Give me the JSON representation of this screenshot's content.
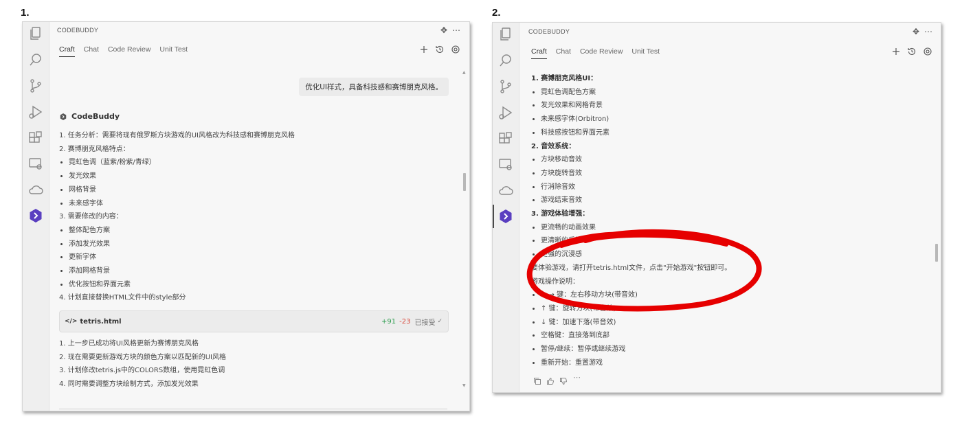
{
  "labels": {
    "left": "1.",
    "right": "2."
  },
  "colors": {
    "accent_dark": "#333333",
    "added": "#2e9c4e",
    "removed": "#d9483b",
    "annotation": "#e60000",
    "logo": "#5a3fc0"
  },
  "panel1": {
    "app_title": "CODEBUDDY",
    "tabs": [
      "Craft",
      "Chat",
      "Code Review",
      "Unit Test"
    ],
    "user_message": "优化UI样式，具备科技感和赛博朋克风格。",
    "bot_name": "CodeBuddy",
    "lines": [
      {
        "text": "1. 任务分析：需要将现有俄罗斯方块游戏的UI风格改为科技感和赛博朋克风格",
        "bullet": false
      },
      {
        "text": "2. 赛博朋克风格特点：",
        "bullet": false
      },
      {
        "text": "霓虹色调（蓝紫/粉紫/青绿）",
        "bullet": true
      },
      {
        "text": "发光效果",
        "bullet": true
      },
      {
        "text": "网格背景",
        "bullet": true
      },
      {
        "text": "未来感字体",
        "bullet": true
      },
      {
        "text": "3. 需要修改的内容：",
        "bullet": false
      },
      {
        "text": "整体配色方案",
        "bullet": true
      },
      {
        "text": "添加发光效果",
        "bullet": true
      },
      {
        "text": "更新字体",
        "bullet": true
      },
      {
        "text": "添加网格背景",
        "bullet": true
      },
      {
        "text": "优化按钮和界面元素",
        "bullet": true
      },
      {
        "text": "4. 计划直接替换HTML文件中的style部分",
        "bullet": false
      }
    ],
    "file_card": {
      "icon": "</>",
      "name": "tetris.html",
      "added": "+91",
      "removed": "-23",
      "status": "已接受"
    },
    "lines_after": [
      "1. 上一步已成功将UI风格更新为赛博朋克风格",
      "2. 现在需要更新游戏方块的颜色方案以匹配新的UI风格",
      "3. 计划修改tetris.js中的COLORS数组，使用霓虹色调",
      "4. 同时需要调整方块绘制方式，添加发光效果"
    ]
  },
  "panel2": {
    "app_title": "CODEBUDDY",
    "tabs": [
      "Craft",
      "Chat",
      "Code Review",
      "Unit Test"
    ],
    "lines": [
      {
        "text": "1. 赛博朋克风格UI：",
        "bullet": false,
        "strong": true
      },
      {
        "text": "霓虹色调配色方案",
        "bullet": true
      },
      {
        "text": "发光效果和网格背景",
        "bullet": true
      },
      {
        "text": "未来感字体(Orbitron)",
        "bullet": true
      },
      {
        "text": "科技感按钮和界面元素",
        "bullet": true
      },
      {
        "text": "2. 音效系统：",
        "bullet": false,
        "strong": true
      },
      {
        "text": "方块移动音效",
        "bullet": true
      },
      {
        "text": "方块旋转音效",
        "bullet": true
      },
      {
        "text": "行消除音效",
        "bullet": true
      },
      {
        "text": "游戏结束音效",
        "bullet": true
      },
      {
        "text": "3. 游戏体验增强：",
        "bullet": false,
        "strong": true
      },
      {
        "text": "更流畅的动画效果",
        "bullet": true
      },
      {
        "text": "更清晰的反馈",
        "bullet": true
      },
      {
        "text": "更强的沉浸感",
        "bullet": true
      },
      {
        "text": "要体验游戏，请打开tetris.html文件，点击\"开始游戏\"按钮即可。",
        "bullet": false
      },
      {
        "text": "游戏操作说明：",
        "bullet": false
      },
      {
        "text": "← → 键：左右移动方块(带音效)",
        "bullet": true
      },
      {
        "text": "↑ 键：旋转方块(带音效)",
        "bullet": true
      },
      {
        "text": "↓ 键：加速下落(带音效)",
        "bullet": true
      },
      {
        "text": "空格键：直接落到底部",
        "bullet": true
      },
      {
        "text": "暂停/继续：暂停或继续游戏",
        "bullet": true
      },
      {
        "text": "重新开始：重置游戏",
        "bullet": true
      }
    ],
    "footer_icons": [
      "copy-icon",
      "thumbs-up-icon",
      "thumbs-down-icon",
      "more-icon"
    ]
  }
}
